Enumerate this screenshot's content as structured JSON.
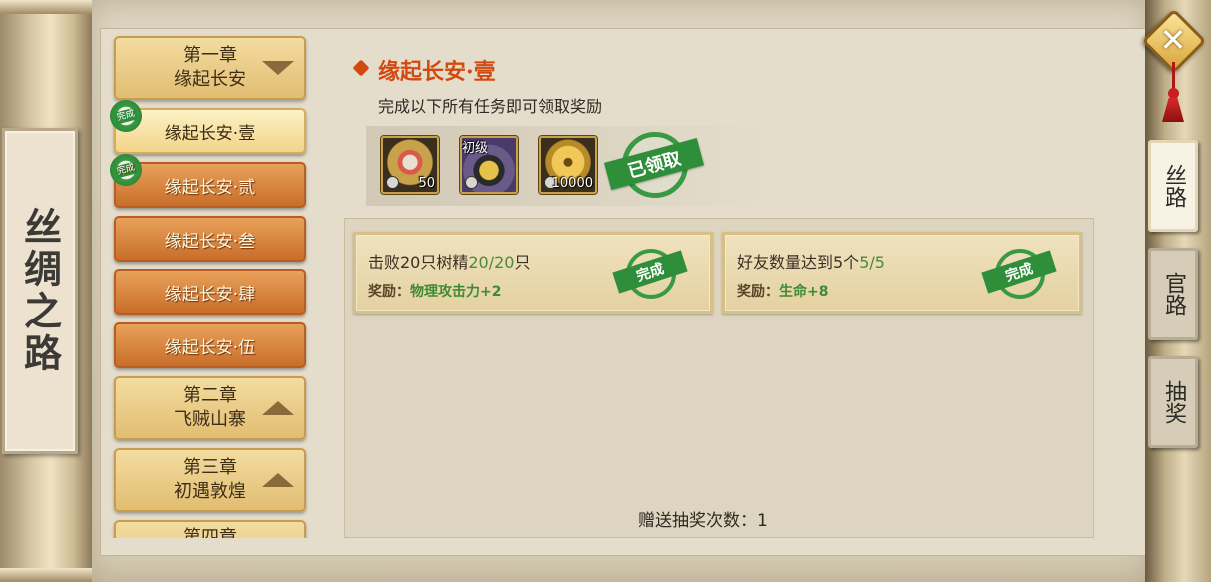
{
  "scroll": {
    "title": "丝绸之路"
  },
  "chapters": [
    {
      "type": "chapter",
      "line1": "第一章",
      "line2": "缘起长安",
      "expanded": true
    },
    {
      "type": "quest",
      "label": "缘起长安·壹",
      "selected": true,
      "done": true,
      "done_label": "完成"
    },
    {
      "type": "quest",
      "label": "缘起长安·贰",
      "selected": false,
      "done": true,
      "done_label": "完成"
    },
    {
      "type": "quest",
      "label": "缘起长安·叁",
      "selected": false,
      "done": false
    },
    {
      "type": "quest",
      "label": "缘起长安·肆",
      "selected": false,
      "done": false
    },
    {
      "type": "quest",
      "label": "缘起长安·伍",
      "selected": false,
      "done": false
    },
    {
      "type": "chapter",
      "line1": "第二章",
      "line2": "飞贼山寨",
      "expanded": false
    },
    {
      "type": "chapter",
      "line1": "第三章",
      "line2": "初遇敦煌",
      "expanded": false
    },
    {
      "type": "chapter",
      "line1": "第四章",
      "line2": "",
      "expanded": false
    }
  ],
  "main": {
    "title": "缘起长安·壹",
    "subtitle": "完成以下所有任务即可领取奖励",
    "rewards": [
      {
        "icon": "medal-badge-icon",
        "quantity": "50"
      },
      {
        "icon": "pouch-icon",
        "tier": "初级",
        "quantity": ""
      },
      {
        "icon": "copper-coin-icon",
        "quantity": "10000"
      }
    ],
    "claimed_stamp": "已领取",
    "tasks": [
      {
        "name": "击败20只树精",
        "progress": "20/20",
        "unit": "只",
        "reward_label": "奖励：",
        "reward_value": "物理攻击力+2",
        "status": "完成"
      },
      {
        "name": "好友数量达到5个",
        "progress": "5/5",
        "unit": "",
        "reward_label": "奖励：",
        "reward_value": "生命+8",
        "status": "完成"
      }
    ],
    "lottery_label": "赠送抽奖次数：",
    "lottery_count": "1"
  },
  "side_tabs": [
    {
      "label": "丝路",
      "active": true
    },
    {
      "label": "官路",
      "active": false
    },
    {
      "label": "抽奖",
      "active": false
    }
  ],
  "colors": {
    "accent": "#d24a10",
    "done_green": "#2e8e3a",
    "quest_orange": "#c86e2a"
  }
}
